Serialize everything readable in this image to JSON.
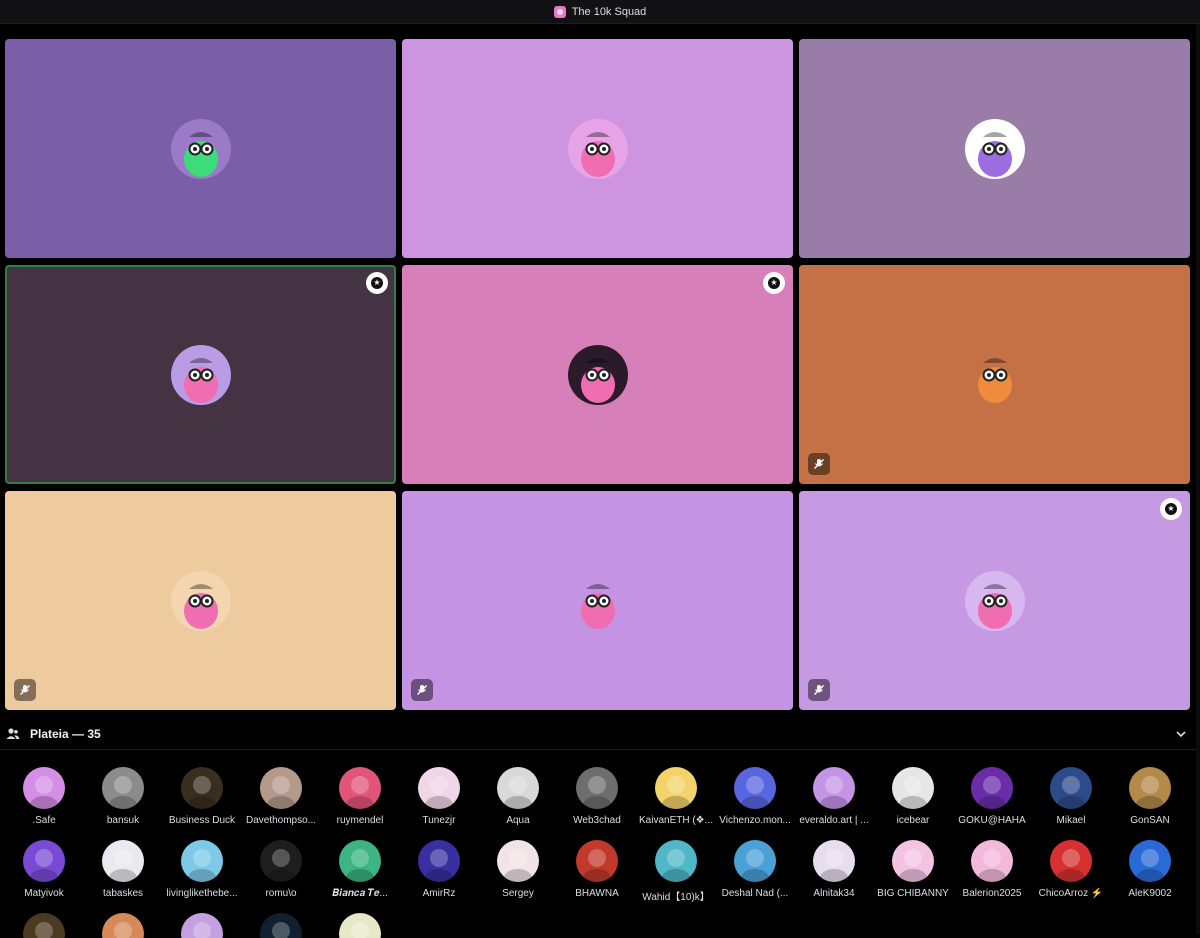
{
  "window": {
    "title": "The 10k Squad",
    "server_icon": "server-icon"
  },
  "stage": {
    "tiles": [
      {
        "bg": "#7a5ea8",
        "avatar_bg": "#9b7ac8",
        "accent": "#3cdc7a",
        "speaking": false,
        "moderator": false,
        "muted": false
      },
      {
        "bg": "#cd95e0",
        "avatar_bg": "#e7a3e6",
        "accent": "#f06db1",
        "speaking": false,
        "moderator": false,
        "muted": false
      },
      {
        "bg": "#9a7ca8",
        "avatar_bg": "#ffffff",
        "accent": "#9a6ee0",
        "speaking": false,
        "moderator": false,
        "muted": false
      },
      {
        "bg": "#443342",
        "avatar_bg": "#b99be6",
        "accent": "#f06db1",
        "speaking": true,
        "moderator": true,
        "muted": false
      },
      {
        "bg": "#d67fb8",
        "avatar_bg": "#2a1a2a",
        "accent": "#f06db1",
        "speaking": false,
        "moderator": true,
        "muted": false
      },
      {
        "bg": "#c47245",
        "avatar_bg": "#c47245",
        "accent": "#f08a3c",
        "speaking": false,
        "moderator": false,
        "muted": true
      },
      {
        "bg": "#eecb9f",
        "avatar_bg": "#f3d6b0",
        "accent": "#f06db1",
        "speaking": false,
        "moderator": false,
        "muted": true
      },
      {
        "bg": "#c493e3",
        "avatar_bg": "#c493e3",
        "accent": "#f06db1",
        "speaking": false,
        "moderator": false,
        "muted": true
      },
      {
        "bg": "#c69ae3",
        "avatar_bg": "#d7b7f0",
        "accent": "#f06db1",
        "speaking": false,
        "moderator": true,
        "muted": true
      }
    ]
  },
  "audience": {
    "label": "Plateia — 35",
    "members": [
      {
        "name": ".Safe",
        "color": "#d58ee6"
      },
      {
        "name": "bansuk",
        "color": "#8c8c8c"
      },
      {
        "name": "Business Duck",
        "color": "#3a2f1f"
      },
      {
        "name": "Davethompso...",
        "color": "#b59a8c"
      },
      {
        "name": "ruymendel",
        "color": "#e1557a"
      },
      {
        "name": "Tunezjr",
        "color": "#f0d6e6"
      },
      {
        "name": "Aqua",
        "color": "#d9d9d9"
      },
      {
        "name": "Web3chad",
        "color": "#6e6e6e"
      },
      {
        "name": "KaivanETH (❖...",
        "color": "#f3d36b"
      },
      {
        "name": "Vichenzo.mon...",
        "color": "#5866e0"
      },
      {
        "name": "everaldo.art | ...",
        "color": "#c494e6"
      },
      {
        "name": "icebear",
        "color": "#e6e6e6"
      },
      {
        "name": "GOKU@HAHA",
        "color": "#6a2da8"
      },
      {
        "name": "Mikael",
        "color": "#2d4a8a"
      },
      {
        "name": "GonSAN",
        "color": "#b48a4a"
      },
      {
        "name": "Matyivok",
        "color": "#7a4ad6"
      },
      {
        "name": "tabaskes",
        "color": "#e9e9ef"
      },
      {
        "name": "livinglikethebe...",
        "color": "#7ec8e8"
      },
      {
        "name": "romu\\o",
        "color": "#1e1e1e"
      },
      {
        "name": "𝑩𝒊𝒂𝒏𝒄𝒂 𝑻𝒆...",
        "color": "#3ab583"
      },
      {
        "name": "AmirRz",
        "color": "#3a2fa0"
      },
      {
        "name": "Sergey",
        "color": "#f1e3e6"
      },
      {
        "name": "BHAWNA",
        "color": "#c0392b"
      },
      {
        "name": "Wahid【10)k】",
        "color": "#4fb7c8"
      },
      {
        "name": "Deshal Nad (...",
        "color": "#4aa1d6"
      },
      {
        "name": "Alnitak34",
        "color": "#e8dcef"
      },
      {
        "name": "BIG CHIBANNY",
        "color": "#f3c3e4"
      },
      {
        "name": "Balerion2025",
        "color": "#f3b9dc"
      },
      {
        "name": "ChicoArroz ⚡",
        "color": "#d63030"
      },
      {
        "name": "AleK9002",
        "color": "#2a6ad6"
      },
      {
        "name": "",
        "color": "#4a3a20"
      },
      {
        "name": "",
        "color": "#d68a5a"
      },
      {
        "name": "",
        "color": "#c4a0e0"
      },
      {
        "name": "",
        "color": "#102030"
      },
      {
        "name": "",
        "color": "#e8e8c8"
      }
    ]
  }
}
